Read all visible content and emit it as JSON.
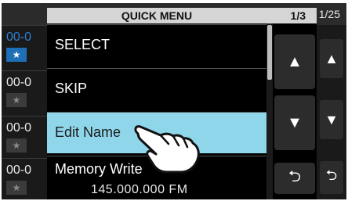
{
  "background_list": {
    "rows": [
      {
        "channel": "00-0",
        "star": "★",
        "selected": true
      },
      {
        "channel": "00-0",
        "star": "★",
        "selected": false
      },
      {
        "channel": "00-0",
        "star": "★",
        "selected": false
      },
      {
        "channel": "00-0",
        "star": "★",
        "selected": false
      }
    ],
    "page_count": "1/25"
  },
  "quick_menu": {
    "title": "QUICK MENU",
    "page": "1/3",
    "items": [
      {
        "label": "SELECT"
      },
      {
        "label": "SKIP"
      },
      {
        "label": "Edit Name",
        "selected": true
      },
      {
        "label": "Memory Write",
        "detail": "145.000.000   FM"
      }
    ],
    "buttons": {
      "up": "▲",
      "down": "▼",
      "back": "⮌"
    }
  },
  "colors": {
    "highlight": "#8fd6ea",
    "selected_channel": "#2d7fd0"
  }
}
